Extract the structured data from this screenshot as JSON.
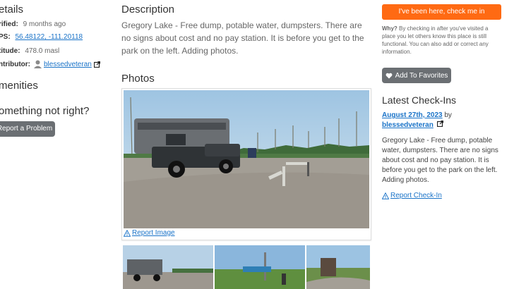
{
  "left": {
    "details_heading": "etails",
    "verified_label": "rified:",
    "verified_value": "9 months ago",
    "gps_label": "PS:",
    "gps_value": "56.48122, -111.20118",
    "altitude_label": "titude:",
    "altitude_value": "478.0 masl",
    "contributor_label": "ntributor:",
    "contributor_name": "blessedveteran",
    "amenities_heading": "menities",
    "problem_heading": "omething not right?",
    "report_problem_label": "Report a Problem"
  },
  "middle": {
    "description_heading": "Description",
    "description_text": "Gregory Lake - Free dump, potable water, dumpsters. There are no signs about cost and no pay station. It is before you get to the park on the left. Adding photos.",
    "photos_heading": "Photos",
    "report_image_label": "Report Image"
  },
  "right": {
    "check_in_button": "I've been here, check me in",
    "why_label": "Why?",
    "why_text": " By checking in after you've visited a place you let others know this place is still functional. You can also add or correct any information.",
    "favorites_button": "Add To Favorites",
    "latest_heading": "Latest Check-Ins",
    "checkin_date": "August 27th, 2023",
    "checkin_by": " by",
    "checkin_user": "blessedveteran",
    "checkin_text": "Gregory Lake - Free dump, potable water, dumpsters. There are no signs about cost and no pay station. It is before you get to the park on the left. Adding photos.",
    "report_checkin_label": "Report Check-In"
  },
  "colors": {
    "accent_orange": "#ff6a13",
    "link_blue": "#1a73c8",
    "button_gray": "#6b6f73"
  }
}
